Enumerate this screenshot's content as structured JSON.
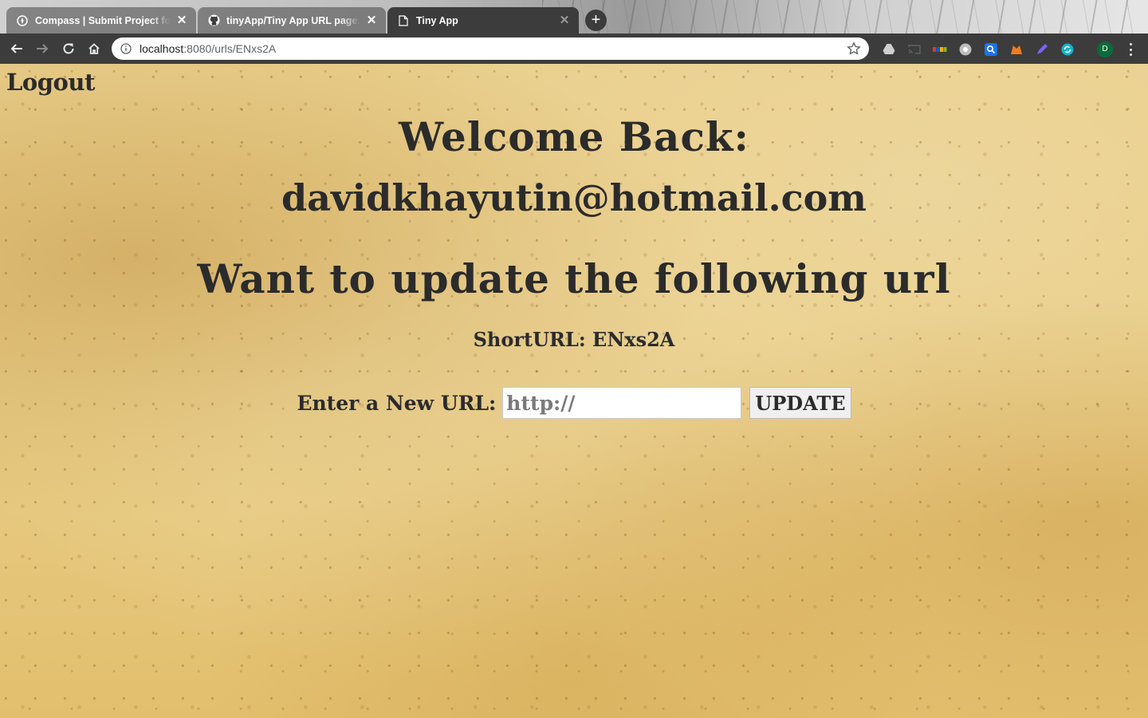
{
  "browser": {
    "tabs": [
      {
        "title": "Compass | Submit Project for E",
        "icon": "compass-icon",
        "active": false
      },
      {
        "title": "tinyApp/Tiny App URL page.png",
        "icon": "github-icon",
        "active": false
      },
      {
        "title": "Tiny App",
        "icon": "page-icon",
        "active": true
      }
    ],
    "new_tab_label": "+",
    "address": {
      "host": "localhost",
      "path": ":8080/urls/ENxs2A"
    },
    "profile_initial": "D",
    "close_symbol": "✕"
  },
  "page": {
    "logout_label": "Logout",
    "welcome_heading": "Welcome Back:",
    "user_email": "davidkhayutin@hotmail.com",
    "update_heading": "Want to update the following url",
    "short_url_text": "ShortURL: ENxs2A",
    "new_url_label": "Enter a New URL:",
    "new_url_placeholder": "http://",
    "update_button_label": "UPDATE"
  },
  "colors": {
    "toolbar": "#3c3c3c",
    "parchment": "#e8cd86",
    "text": "#2b2b2b"
  }
}
